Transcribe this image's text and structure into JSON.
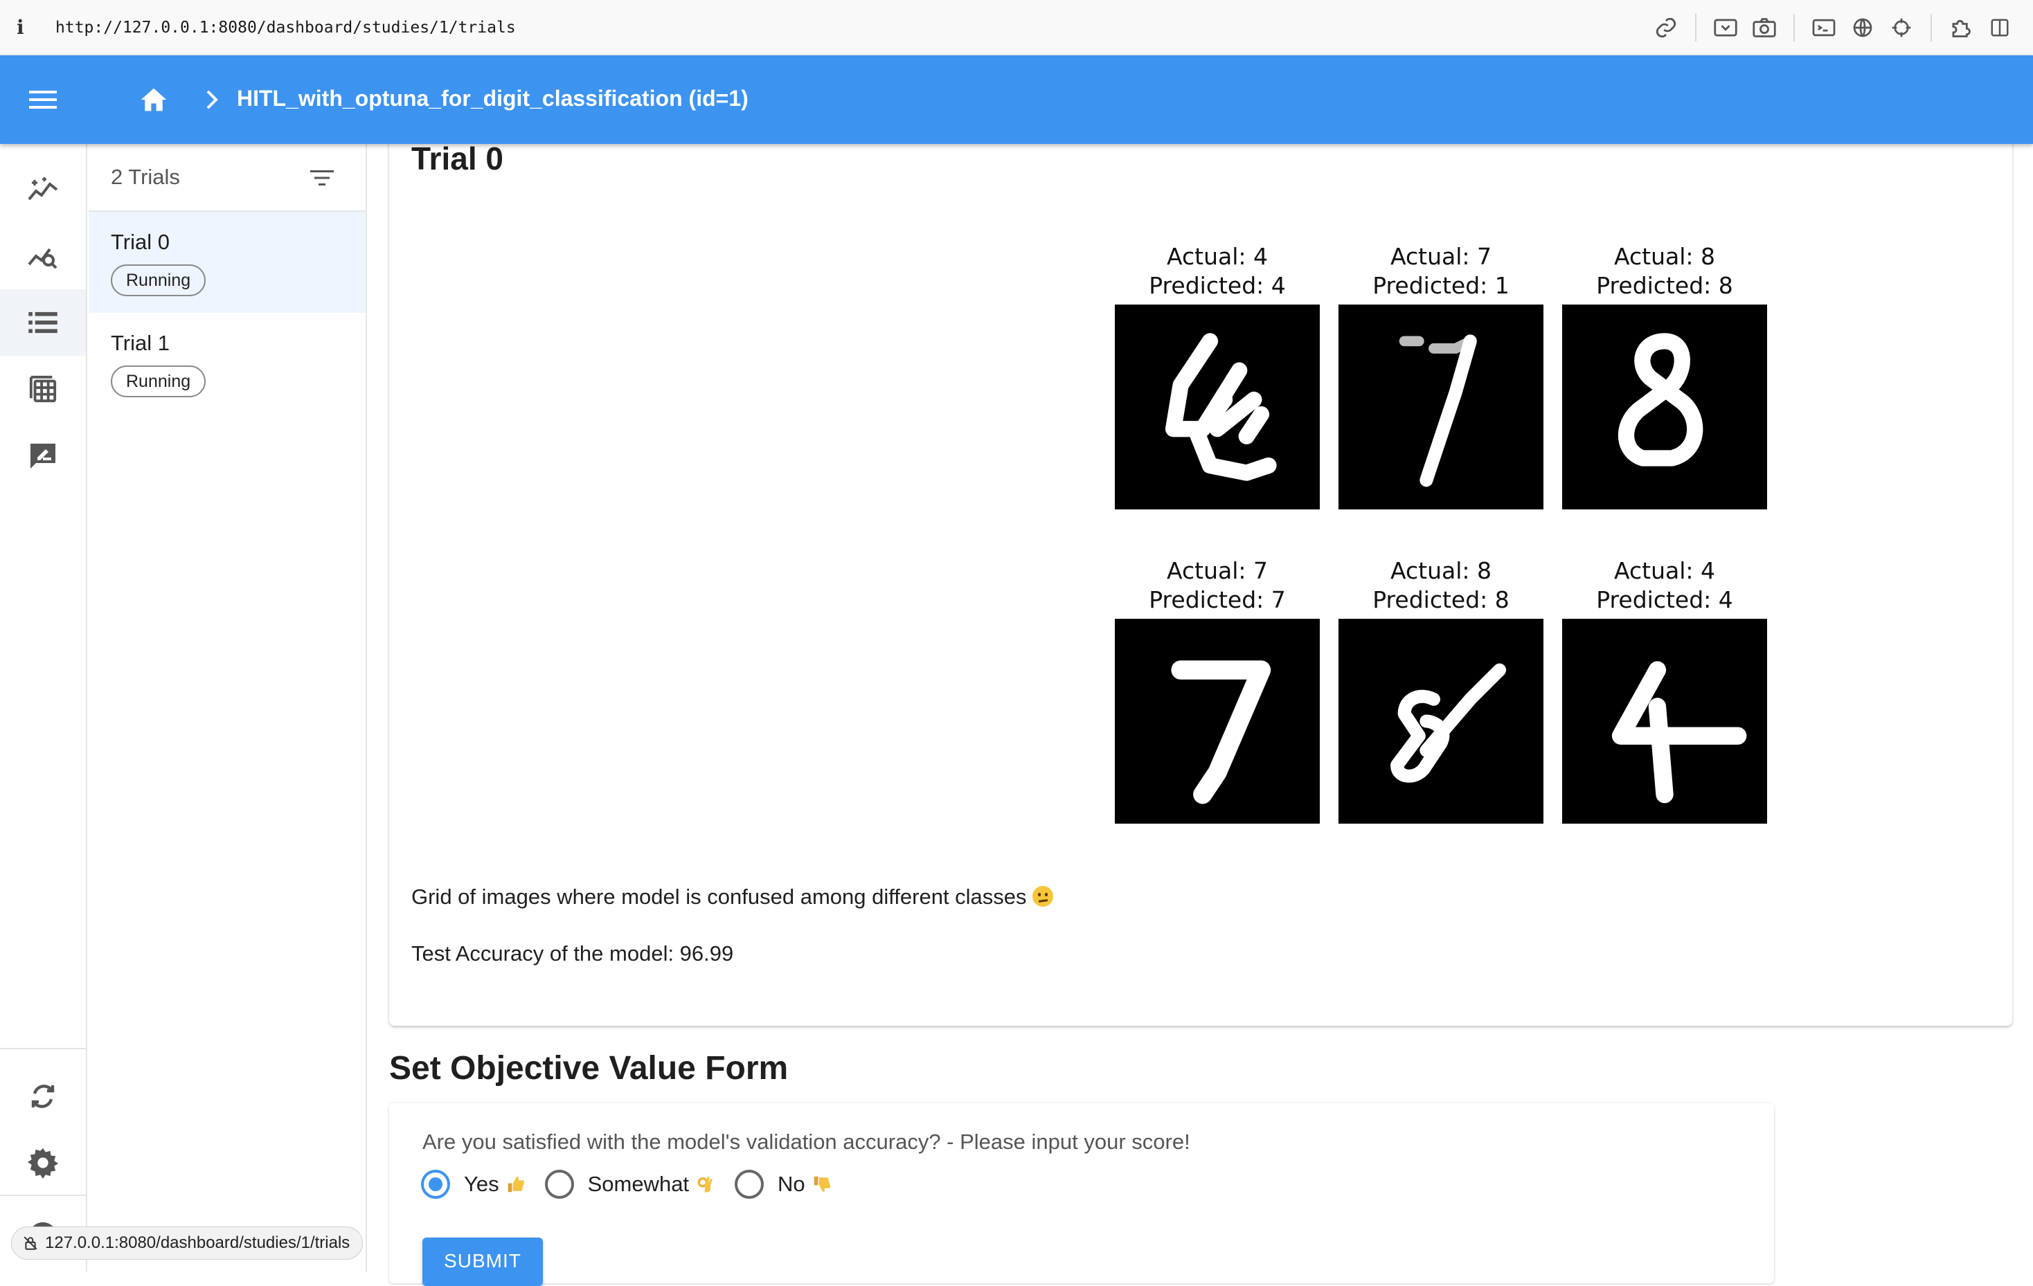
{
  "browser": {
    "info_glyph": "i",
    "url": "http://127.0.0.1:8080/dashboard/studies/1/trials",
    "toolbar_icons": [
      "link-icon",
      "reader-icon",
      "camera-icon",
      "terminal-icon",
      "globe-icon",
      "crosshair-icon",
      "extensions-icon",
      "sidebar-icon"
    ]
  },
  "app_bar": {
    "color": "#3d93f0",
    "study_title": "HITL_with_optuna_for_digit_classification (id=1)"
  },
  "rail": {
    "items": [
      "history-sparkle-icon",
      "analytics-search-icon",
      "trial-list-icon",
      "trial-table-icon",
      "note-edit-icon"
    ],
    "active_index": 2,
    "bottom_items": [
      "reload-icon",
      "settings-icon",
      "github-icon"
    ]
  },
  "trial_list": {
    "count_label": "2 Trials",
    "trials": [
      {
        "title": "Trial 0",
        "status": "Running",
        "selected": true
      },
      {
        "title": "Trial 1",
        "status": "Running",
        "selected": false
      }
    ]
  },
  "trial_detail": {
    "heading": "Trial 0",
    "digits": [
      {
        "actual_label": "Actual: 4",
        "predicted_label": "Predicted: 4"
      },
      {
        "actual_label": "Actual: 7",
        "predicted_label": "Predicted: 1"
      },
      {
        "actual_label": "Actual: 8",
        "predicted_label": "Predicted: 8"
      },
      {
        "actual_label": "Actual: 7",
        "predicted_label": "Predicted: 7"
      },
      {
        "actual_label": "Actual: 8",
        "predicted_label": "Predicted: 8"
      },
      {
        "actual_label": "Actual: 4",
        "predicted_label": "Predicted: 4"
      }
    ],
    "caption": "Grid of images where model is confused among different classes",
    "accuracy_text": "Test Accuracy of the model: 96.99"
  },
  "form": {
    "heading": "Set Objective Value Form",
    "question": "Are you satisfied with the model's validation accuracy? - Please input your score!",
    "options": [
      {
        "label": "Yes",
        "emoji": "thumbs-up-icon",
        "checked": true
      },
      {
        "label": "Somewhat",
        "emoji": "ok-hand-icon",
        "checked": false
      },
      {
        "label": "No",
        "emoji": "thumbs-down-icon",
        "checked": false
      }
    ],
    "submit_label": "SUBMIT"
  },
  "status_bar": {
    "url": "127.0.0.1:8080/dashboard/studies/1/trials"
  }
}
